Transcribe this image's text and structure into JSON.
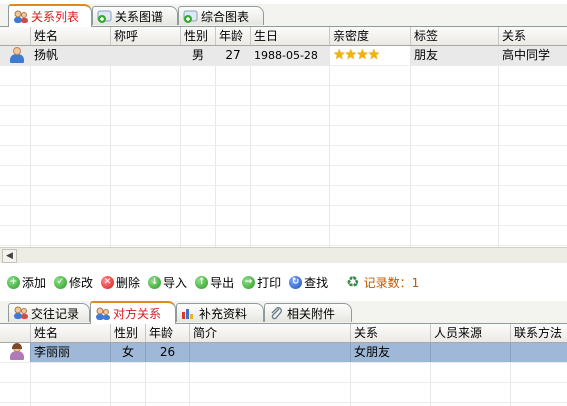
{
  "top_tabs": [
    {
      "label": "关系列表",
      "icon": "people-icon",
      "active": true
    },
    {
      "label": "关系图谱",
      "icon": "graph-add-icon",
      "active": false
    },
    {
      "label": "综合图表",
      "icon": "chart-add-icon",
      "active": false
    }
  ],
  "relation_table": {
    "columns": [
      "姓名",
      "称呼",
      "性别",
      "年龄",
      "生日",
      "亲密度",
      "标签",
      "关系"
    ],
    "rows": [
      {
        "avatar": "male-user-icon",
        "name": "扬帆",
        "title": "",
        "gender": "男",
        "age": "27",
        "birthday": "1988-05-28",
        "intimacy_stars": 4,
        "intimacy_text": "★★★★",
        "tag": "朋友",
        "relation": "高中同学"
      }
    ]
  },
  "toolbar": {
    "add": "添加",
    "edit": "修改",
    "delete": "删除",
    "import": "导入",
    "export": "导出",
    "print": "打印",
    "find": "查找",
    "record_count": "记录数：1"
  },
  "bottom_tabs": [
    {
      "label": "交往记录",
      "icon": "people-icon",
      "active": false
    },
    {
      "label": "对方关系",
      "icon": "people-icon",
      "active": true
    },
    {
      "label": "补充资料",
      "icon": "bar-chart-icon",
      "active": false
    },
    {
      "label": "相关附件",
      "icon": "paperclip-icon",
      "active": false
    }
  ],
  "counterpart_table": {
    "columns": [
      "姓名",
      "性别",
      "年龄",
      "简介",
      "关系",
      "人员来源",
      "联系方法"
    ],
    "rows": [
      {
        "avatar": "female-user-icon",
        "name": "李丽丽",
        "gender": "女",
        "age": "26",
        "intro": "",
        "relation": "女朋友",
        "source": "",
        "contact": ""
      }
    ]
  },
  "colors": {
    "active_tab_text": "#d61c1c",
    "selected_row": "#9fb8d8",
    "record_count": "#c05a00",
    "stars": "#f4b300"
  }
}
